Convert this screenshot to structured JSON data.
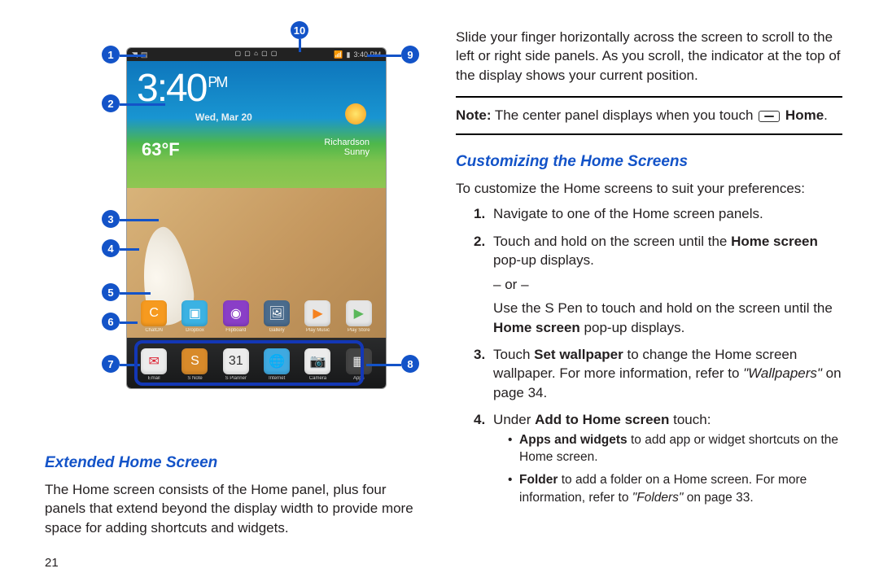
{
  "pageNumber": "21",
  "leftHeading": "Extended Home Screen",
  "leftPara": "The Home screen consists of the Home panel, plus four panels that extend beyond the display width to provide more space for adding shortcuts and widgets.",
  "rightPara": "Slide your finger horizontally across the screen to scroll to the left or right side panels. As you scroll, the indicator at the top of the display shows your current position.",
  "note": {
    "lead": "Note:",
    "body": "The center panel displays when you touch",
    "homeLabel": "Home"
  },
  "rightHeading": "Customizing the Home Screens",
  "customizeIntro": "To customize the Home screens to suit your preferences:",
  "steps": {
    "s1": {
      "n": "1.",
      "t": "Navigate to one of the Home screen panels."
    },
    "s2": {
      "n": "2.",
      "a": "Touch and hold on the screen until the ",
      "b": "Home screen",
      "c": " pop-up displays.",
      "or": "– or –",
      "d": "Use the S Pen to touch and hold on the screen until the ",
      "e": "Home screen",
      "f": " pop-up displays."
    },
    "s3": {
      "n": "3.",
      "a": "Touch ",
      "b": "Set wallpaper",
      "c": " to change the Home screen wallpaper. For more information, refer to ",
      "ref": "\"Wallpapers\"",
      "d": " on page 34."
    },
    "s4": {
      "n": "4.",
      "a": "Under ",
      "b": "Add to Home screen",
      "c": " touch:"
    }
  },
  "bullets": {
    "b1": {
      "a": "Apps and widgets",
      "b": " to add app or widget shortcuts on the Home screen."
    },
    "b2": {
      "a": "Folder",
      "b": " to add a folder on a Home screen. For more information, refer to ",
      "ref": "\"Folders\"",
      "c": " on page 33."
    }
  },
  "callouts": {
    "1": "1",
    "2": "2",
    "3": "3",
    "4": "4",
    "5": "5",
    "6": "6",
    "7": "7",
    "8": "8",
    "9": "9",
    "10": "10"
  },
  "device": {
    "status": {
      "time": "3:40 PM",
      "wifi": "▲",
      "batt": "▮",
      "sig": "▮"
    },
    "clock": "3:40",
    "ampm": "PM",
    "date": "Wed, Mar 20",
    "temp": "63°F",
    "loc": "Richardson",
    "wx": "Sunny",
    "appsRow": [
      {
        "bg": "#f69a1f",
        "g": "C",
        "l": "ChatON"
      },
      {
        "bg": "#3bb2e3",
        "g": "▣",
        "l": "Dropbox"
      },
      {
        "bg": "#8a3ec7",
        "g": "◉",
        "l": "Flipboard"
      },
      {
        "bg": "#4a6b8c",
        "g": "🖼",
        "l": "Gallery"
      },
      {
        "bg": "#e6e6e6",
        "g": "▶",
        "l": "Play Music",
        "fg": "#f58220"
      },
      {
        "bg": "#e6e6e6",
        "g": "▶",
        "l": "Play Store",
        "fg": "#5bb85b"
      }
    ],
    "dock": [
      {
        "bg": "#ececec",
        "g": "✉",
        "l": "Email",
        "fg": "#d23"
      },
      {
        "bg": "#d88a2a",
        "g": "S",
        "l": "S Note"
      },
      {
        "bg": "#ececec",
        "g": "31",
        "l": "S Planner",
        "fg": "#333"
      },
      {
        "bg": "#3fa9e0",
        "g": "🌐",
        "l": "Internet"
      },
      {
        "bg": "#ececec",
        "g": "📷",
        "l": "Camera",
        "fg": "#333"
      },
      {
        "bg": "#444",
        "g": "▦",
        "l": "Apps",
        "fg": "#eee"
      }
    ]
  }
}
